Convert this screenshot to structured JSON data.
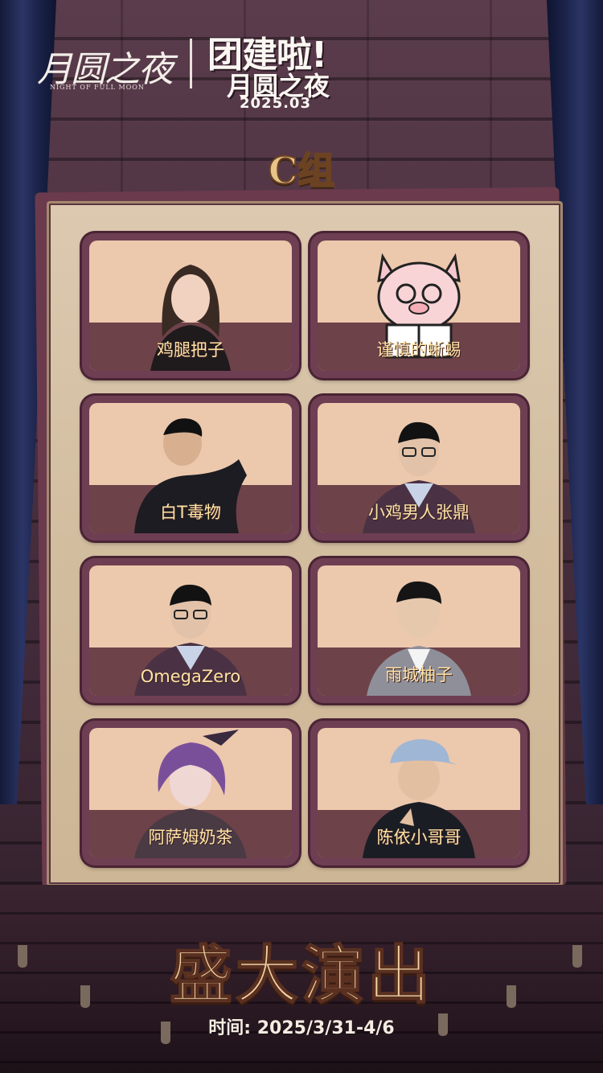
{
  "header": {
    "logo_cn": "月圆之夜",
    "logo_en": "NIGHT OF FULL MOON",
    "event_title": "团建啦!",
    "event_sub": "月圆之夜",
    "event_date": "2025.03"
  },
  "group_title": "C组",
  "players": [
    {
      "name": "鸡腿把子",
      "avatar": "woman-portrait"
    },
    {
      "name": "谨慎的蜥蜴",
      "avatar": "pig-cartoon"
    },
    {
      "name": "白T毒物",
      "avatar": "man-black-jacket"
    },
    {
      "name": "小鸡男人张鼎",
      "avatar": "man-glasses-robe"
    },
    {
      "name": "OmegaZero",
      "avatar": "man-glasses-robe"
    },
    {
      "name": "雨城柚子",
      "avatar": "man-suit"
    },
    {
      "name": "阿萨姆奶茶",
      "avatar": "anime-purple-hair"
    },
    {
      "name": "陈依小哥哥",
      "avatar": "man-cap-hoodie"
    }
  ],
  "footer": {
    "show_title": "盛大演出",
    "time_label": "时间:",
    "time_value": "2025/3/31-4/6"
  }
}
